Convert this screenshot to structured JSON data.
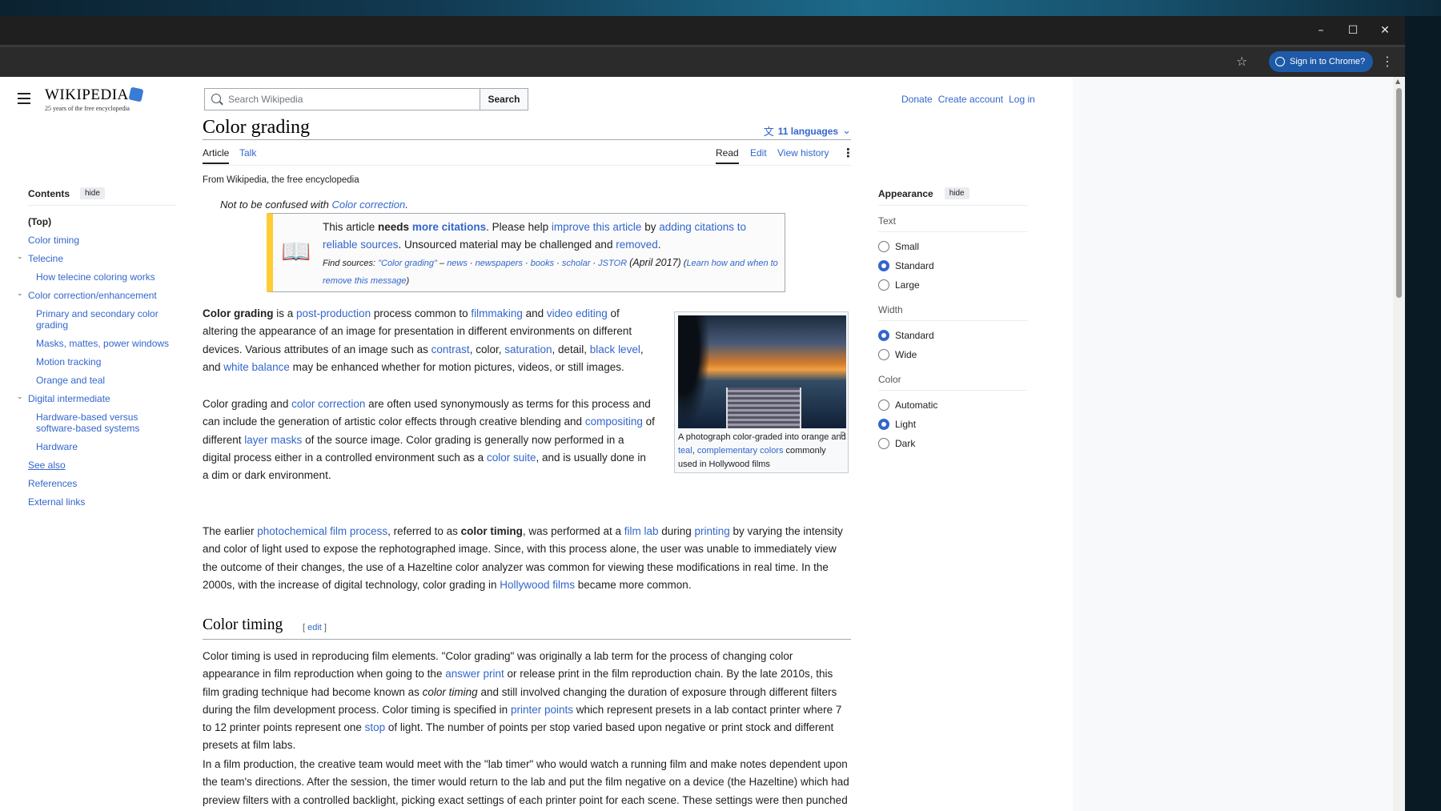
{
  "browser": {
    "controls": {
      "minimize": "–",
      "maximize": "☐",
      "close": "✕"
    },
    "signin_label": "Sign in to Chrome?",
    "star_icon": "star-icon",
    "menu_icon": "kebab-icon"
  },
  "header": {
    "logo_word": "WIKIPEDIA",
    "logo_tagline": "25 years of the free encyclopedia",
    "search_placeholder": "Search Wikipedia",
    "search_button": "Search",
    "links": [
      "Donate",
      "Create account",
      "Log in"
    ]
  },
  "toc": {
    "title": "Contents",
    "hide": "hide",
    "items": [
      {
        "label": "(Top)",
        "level": 0,
        "top": true
      },
      {
        "label": "Color timing",
        "level": 0
      },
      {
        "label": "Telecine",
        "level": 0,
        "collapsible": true
      },
      {
        "label": "How telecine coloring works",
        "level": 1
      },
      {
        "label": "Color correction/enhancement",
        "level": 0,
        "collapsible": true
      },
      {
        "label": "Primary and secondary color grading",
        "level": 1
      },
      {
        "label": "Masks, mattes, power windows",
        "level": 1
      },
      {
        "label": "Motion tracking",
        "level": 1
      },
      {
        "label": "Orange and teal",
        "level": 1
      },
      {
        "label": "Digital intermediate",
        "level": 0,
        "collapsible": true
      },
      {
        "label": "Hardware-based versus software-based systems",
        "level": 1
      },
      {
        "label": "Hardware",
        "level": 1
      },
      {
        "label": "See also",
        "level": 0,
        "underline": true
      },
      {
        "label": "References",
        "level": 0
      },
      {
        "label": "External links",
        "level": 0
      }
    ]
  },
  "article": {
    "title": "Color grading",
    "languages": "11 languages",
    "tabs_left": [
      "Article",
      "Talk"
    ],
    "tabs_right": [
      "Read",
      "Edit",
      "View history"
    ],
    "from": "From Wikipedia, the free encyclopedia",
    "hatnote_prefix": "Not to be confused with ",
    "hatnote_link": "Color correction",
    "hatnote_suffix": ".",
    "ambox": {
      "p1": "This article ",
      "needs": "needs ",
      "more_citations": "more citations",
      "p2": ". Please help ",
      "improve": "improve this article",
      "p3": " by ",
      "adding": "adding citations to reliable sources",
      "p4": ". Unsourced material may be challenged and ",
      "removed": "removed",
      "p5": ".",
      "find_label": "Find sources: ",
      "find_query": "\"Color grading\"",
      "find_sep": " – ",
      "find_links": [
        "news",
        "newspapers",
        "books",
        "scholar",
        "JSTOR"
      ],
      "date": "(April 2017)",
      "learn": "Learn how and when to remove this message"
    },
    "figure_caption_1": "A photograph color-graded into orange and ",
    "figure_caption_teal": "teal",
    "figure_caption_2": ", ",
    "figure_caption_comp": "complementary colors",
    "figure_caption_3": " commonly used in Hollywood films",
    "section2_title": "Color timing",
    "section2_edit": "edit"
  },
  "appearance": {
    "title": "Appearance",
    "hide": "hide",
    "groups": [
      {
        "label": "Text",
        "options": [
          "Small",
          "Standard",
          "Large"
        ],
        "selected": "Standard"
      },
      {
        "label": "Width",
        "options": [
          "Standard",
          "Wide"
        ],
        "selected": "Standard"
      },
      {
        "label": "Color",
        "options": [
          "Automatic",
          "Light",
          "Dark"
        ],
        "selected": "Light"
      }
    ]
  },
  "colors": {
    "link": "#3366cc",
    "ambox_stripe": "#ffcc33",
    "signin_bg": "#1e5aa8"
  }
}
